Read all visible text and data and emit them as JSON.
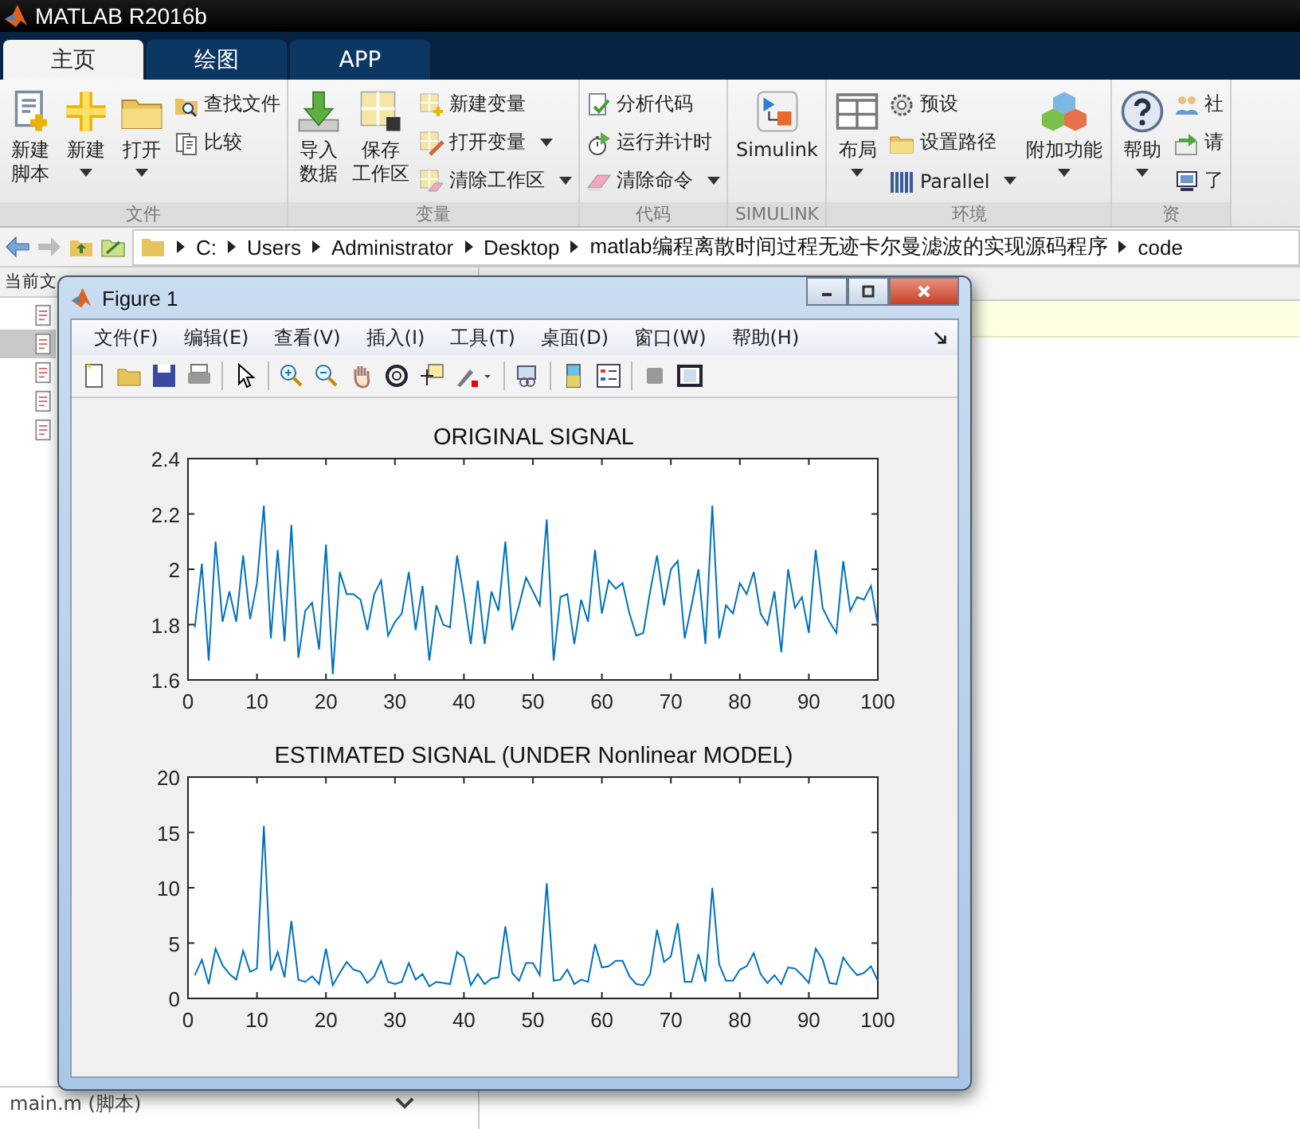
{
  "app_title": "MATLAB R2016b",
  "tabs": [
    {
      "label": "主页",
      "selected": true
    },
    {
      "label": "绘图",
      "selected": false
    },
    {
      "label": "APP",
      "selected": false
    }
  ],
  "ribbon": {
    "groups": [
      {
        "label": "文件",
        "items": [
          {
            "kind": "large",
            "lines": [
              "新建",
              "脚本"
            ],
            "dropdown": false
          },
          {
            "kind": "large",
            "lines": [
              "新建"
            ],
            "dropdown": true
          },
          {
            "kind": "large",
            "lines": [
              "打开"
            ],
            "dropdown": true
          },
          {
            "kind": "stack",
            "items": [
              {
                "label": "查找文件",
                "dropdown": false
              },
              {
                "label": "比较",
                "dropdown": false
              }
            ]
          }
        ]
      },
      {
        "label": "变量",
        "items": [
          {
            "kind": "large",
            "lines": [
              "导入",
              "数据"
            ],
            "dropdown": false
          },
          {
            "kind": "large",
            "lines": [
              "保存",
              "工作区"
            ],
            "dropdown": false
          },
          {
            "kind": "stack",
            "items": [
              {
                "label": "新建变量",
                "dropdown": false
              },
              {
                "label": "打开变量",
                "dropdown": true
              },
              {
                "label": "清除工作区",
                "dropdown": true
              }
            ]
          }
        ]
      },
      {
        "label": "代码",
        "items": [
          {
            "kind": "stack",
            "items": [
              {
                "label": "分析代码",
                "dropdown": false
              },
              {
                "label": "运行并计时",
                "dropdown": false
              },
              {
                "label": "清除命令",
                "dropdown": true
              }
            ]
          }
        ]
      },
      {
        "label": "SIMULINK",
        "items": [
          {
            "kind": "large",
            "lines": [
              "Simulink"
            ],
            "dropdown": false
          }
        ]
      },
      {
        "label": "环境",
        "items": [
          {
            "kind": "large",
            "lines": [
              "布局"
            ],
            "dropdown": true
          },
          {
            "kind": "stack",
            "items": [
              {
                "label": "预设",
                "dropdown": false
              },
              {
                "label": "设置路径",
                "dropdown": false
              },
              {
                "label": "Parallel",
                "dropdown": true
              }
            ]
          },
          {
            "kind": "large",
            "lines": [
              "附加功能"
            ],
            "dropdown": true
          }
        ]
      },
      {
        "label": "资",
        "items": [
          {
            "kind": "large",
            "lines": [
              "帮助"
            ],
            "dropdown": true
          },
          {
            "kind": "stack",
            "items": [
              {
                "label": "社",
                "dropdown": false
              },
              {
                "label": "请",
                "dropdown": false
              },
              {
                "label": "了",
                "dropdown": false
              }
            ]
          }
        ]
      }
    ]
  },
  "path": [
    "C:",
    "Users",
    "Administrator",
    "Desktop",
    "matlab编程离散时间过程无迹卡尔曼滤波的实现源码程序",
    "code"
  ],
  "current_folder": {
    "title": "当前文",
    "files": [
      {
        "selected": false
      },
      {
        "selected": true
      },
      {
        "selected": false
      },
      {
        "selected": false
      },
      {
        "selected": false
      }
    ],
    "footer": "main.m  (脚本)"
  },
  "figure": {
    "title": "Figure 1",
    "menus": [
      "文件(F)",
      "编辑(E)",
      "查看(V)",
      "插入(I)",
      "工具(T)",
      "桌面(D)",
      "窗口(W)",
      "帮助(H)"
    ],
    "charts": [
      {
        "chart_data": {
          "type": "line",
          "title": "ORIGINAL SIGNAL",
          "x": [
            1,
            2,
            3,
            4,
            5,
            6,
            7,
            8,
            9,
            10,
            11,
            12,
            13,
            14,
            15,
            16,
            17,
            18,
            19,
            20,
            21,
            22,
            23,
            24,
            25,
            26,
            27,
            28,
            29,
            30,
            31,
            32,
            33,
            34,
            35,
            36,
            37,
            38,
            39,
            40,
            41,
            42,
            43,
            44,
            45,
            46,
            47,
            48,
            49,
            50,
            51,
            52,
            53,
            54,
            55,
            56,
            57,
            58,
            59,
            60,
            61,
            62,
            63,
            64,
            65,
            66,
            67,
            68,
            69,
            70,
            71,
            72,
            73,
            74,
            75,
            76,
            77,
            78,
            79,
            80,
            81,
            82,
            83,
            84,
            85,
            86,
            87,
            88,
            89,
            90,
            91,
            92,
            93,
            94,
            95,
            96,
            97,
            98,
            99,
            100
          ],
          "series": [
            {
              "color": "#0072bd",
              "values": [
                1.79,
                2.02,
                1.67,
                2.1,
                1.81,
                1.92,
                1.81,
                2.05,
                1.82,
                1.95,
                2.23,
                1.75,
                2.07,
                1.74,
                2.16,
                1.68,
                1.85,
                1.88,
                1.71,
                2.09,
                1.62,
                1.99,
                1.91,
                1.91,
                1.89,
                1.78,
                1.91,
                1.96,
                1.76,
                1.81,
                1.84,
                1.99,
                1.78,
                1.94,
                1.67,
                1.87,
                1.8,
                1.79,
                2.05,
                1.9,
                1.73,
                1.96,
                1.73,
                1.92,
                1.85,
                2.1,
                1.78,
                1.87,
                1.97,
                1.92,
                1.87,
                2.18,
                1.67,
                1.9,
                1.91,
                1.73,
                1.89,
                1.81,
                2.07,
                1.84,
                1.96,
                1.93,
                1.95,
                1.84,
                1.76,
                1.77,
                1.92,
                2.05,
                1.87,
                2,
                2.03,
                1.75,
                1.87,
                2,
                1.73,
                2.23,
                1.75,
                1.87,
                1.84,
                1.95,
                1.91,
                1.99,
                1.84,
                1.8,
                1.92,
                1.7,
                2,
                1.86,
                1.9,
                1.77,
                2.07,
                1.86,
                1.81,
                1.77,
                2.03,
                1.85,
                1.9,
                1.89,
                1.94,
                1.8
              ]
            }
          ],
          "xlim": [
            0,
            100
          ],
          "ylim": [
            1.6,
            2.4
          ],
          "xticks": [
            0,
            10,
            20,
            30,
            40,
            50,
            60,
            70,
            80,
            90,
            100
          ],
          "yticks": [
            1.6,
            1.8,
            2,
            2.2,
            2.4
          ]
        }
      },
      {
        "chart_data": {
          "type": "line",
          "title": "ESTIMATED SIGNAL (UNDER Nonlinear MODEL)",
          "x": [
            1,
            2,
            3,
            4,
            5,
            6,
            7,
            8,
            9,
            10,
            11,
            12,
            13,
            14,
            15,
            16,
            17,
            18,
            19,
            20,
            21,
            22,
            23,
            24,
            25,
            26,
            27,
            28,
            29,
            30,
            31,
            32,
            33,
            34,
            35,
            36,
            37,
            38,
            39,
            40,
            41,
            42,
            43,
            44,
            45,
            46,
            47,
            48,
            49,
            50,
            51,
            52,
            53,
            54,
            55,
            56,
            57,
            58,
            59,
            60,
            61,
            62,
            63,
            64,
            65,
            66,
            67,
            68,
            69,
            70,
            71,
            72,
            73,
            74,
            75,
            76,
            77,
            78,
            79,
            80,
            81,
            82,
            83,
            84,
            85,
            86,
            87,
            88,
            89,
            90,
            91,
            92,
            93,
            94,
            95,
            96,
            97,
            98,
            99,
            100
          ],
          "series": [
            {
              "color": "#0072bd",
              "values": [
                2.1,
                3.5,
                1.3,
                4.5,
                3,
                2.2,
                1.7,
                4.3,
                2.4,
                2.7,
                15.6,
                2.5,
                4.2,
                1.9,
                7,
                1.7,
                1.5,
                2,
                1.3,
                4.5,
                1.2,
                2.3,
                3.3,
                2.6,
                2.4,
                1.4,
                2,
                3.4,
                1.5,
                1.3,
                1.5,
                3.2,
                1.7,
                2.2,
                1.1,
                1.5,
                1.4,
                1.3,
                4.2,
                3.7,
                1.2,
                2.2,
                1.3,
                1.8,
                1.9,
                6.5,
                2.3,
                1.6,
                3.2,
                3.2,
                2.1,
                10.4,
                1.6,
                1.7,
                2.6,
                1.3,
                1.7,
                1.5,
                4.9,
                2.8,
                2.9,
                3.4,
                3.4,
                2,
                1.3,
                1.2,
                2.2,
                6.2,
                3.3,
                3.8,
                6.8,
                1.5,
                1.5,
                4,
                1.5,
                10,
                3.1,
                1.6,
                1.6,
                2.6,
                2.9,
                4.1,
                2.2,
                1.4,
                2.1,
                1.3,
                2.8,
                2.7,
                2.1,
                1.4,
                4.5,
                3.5,
                1.4,
                1.3,
                3.7,
                2.8,
                2.1,
                2.3,
                2.9,
                1.6
              ]
            }
          ],
          "xlim": [
            0,
            100
          ],
          "ylim": [
            0,
            20
          ],
          "xticks": [
            0,
            10,
            20,
            30,
            40,
            50,
            60,
            70,
            80,
            90,
            100
          ],
          "yticks": [
            0,
            5,
            10,
            15,
            20
          ]
        }
      }
    ]
  }
}
